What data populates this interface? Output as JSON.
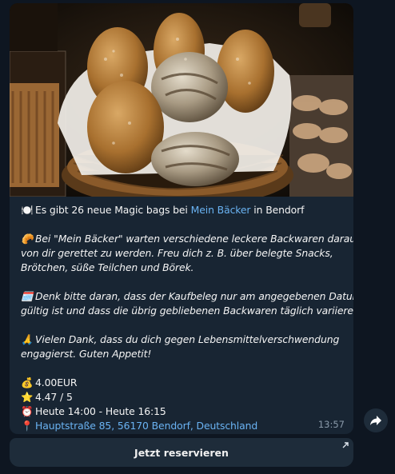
{
  "message": {
    "intro": {
      "emoji": "🍽️",
      "prefix": "Es gibt 26 neue Magic bags bei ",
      "store_link": "Mein Bäcker",
      "suffix": " in Bendorf"
    },
    "para1": {
      "emoji": "🥐",
      "line1": "Bei \"Mein Bäcker\" warten verschiedene leckere Backwaren darauf",
      "line2": "von dir gerettet zu werden. Freu dich z. B. über belegte Snacks,",
      "line3": "Brötchen, süße Teilchen und Börek."
    },
    "para2": {
      "emoji": "🗓️",
      "line1": "Denk bitte daran, dass der Kaufbeleg nur am angegebenen Datum",
      "line2": "gültig ist und dass die übrig gebliebenen Backwaren täglich variieren."
    },
    "para3": {
      "emoji": "🙏",
      "line1": "Vielen Dank, dass du dich gegen Lebensmittelverschwendung",
      "line2": "engagierst. Guten Appetit!"
    },
    "details": {
      "price_emoji": "💰",
      "price": "4.00EUR",
      "rating_emoji": "⭐",
      "rating": "4.47 / 5",
      "time_emoji": "⏰",
      "pickup_time": "Heute 14:00 - Heute 16:15",
      "address_emoji": "📍",
      "address": "Hauptstraße 85, 56170 Bendorf, Deutschland"
    },
    "timestamp": "13:57"
  },
  "button": {
    "label": "Jetzt reservieren"
  },
  "icons": {
    "share": "share-icon",
    "external": "external-link-arrow-icon"
  },
  "colors": {
    "background": "#0e1621",
    "bubble": "#182533",
    "link": "#6ab3f3",
    "button": "#1e2c3a"
  }
}
